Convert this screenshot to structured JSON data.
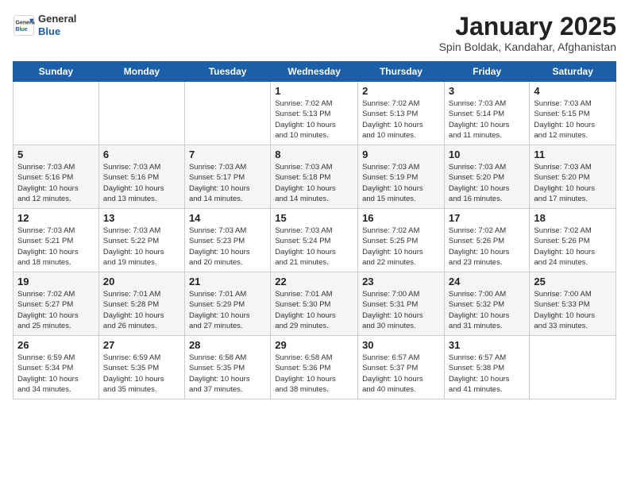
{
  "header": {
    "logo_general": "General",
    "logo_blue": "Blue",
    "month_title": "January 2025",
    "subtitle": "Spin Boldak, Kandahar, Afghanistan"
  },
  "days_of_week": [
    "Sunday",
    "Monday",
    "Tuesday",
    "Wednesday",
    "Thursday",
    "Friday",
    "Saturday"
  ],
  "weeks": [
    [
      {
        "day": "",
        "info": ""
      },
      {
        "day": "",
        "info": ""
      },
      {
        "day": "",
        "info": ""
      },
      {
        "day": "1",
        "info": "Sunrise: 7:02 AM\nSunset: 5:13 PM\nDaylight: 10 hours\nand 10 minutes."
      },
      {
        "day": "2",
        "info": "Sunrise: 7:02 AM\nSunset: 5:13 PM\nDaylight: 10 hours\nand 10 minutes."
      },
      {
        "day": "3",
        "info": "Sunrise: 7:03 AM\nSunset: 5:14 PM\nDaylight: 10 hours\nand 11 minutes."
      },
      {
        "day": "4",
        "info": "Sunrise: 7:03 AM\nSunset: 5:15 PM\nDaylight: 10 hours\nand 12 minutes."
      }
    ],
    [
      {
        "day": "5",
        "info": "Sunrise: 7:03 AM\nSunset: 5:16 PM\nDaylight: 10 hours\nand 12 minutes."
      },
      {
        "day": "6",
        "info": "Sunrise: 7:03 AM\nSunset: 5:16 PM\nDaylight: 10 hours\nand 13 minutes."
      },
      {
        "day": "7",
        "info": "Sunrise: 7:03 AM\nSunset: 5:17 PM\nDaylight: 10 hours\nand 14 minutes."
      },
      {
        "day": "8",
        "info": "Sunrise: 7:03 AM\nSunset: 5:18 PM\nDaylight: 10 hours\nand 14 minutes."
      },
      {
        "day": "9",
        "info": "Sunrise: 7:03 AM\nSunset: 5:19 PM\nDaylight: 10 hours\nand 15 minutes."
      },
      {
        "day": "10",
        "info": "Sunrise: 7:03 AM\nSunset: 5:20 PM\nDaylight: 10 hours\nand 16 minutes."
      },
      {
        "day": "11",
        "info": "Sunrise: 7:03 AM\nSunset: 5:20 PM\nDaylight: 10 hours\nand 17 minutes."
      }
    ],
    [
      {
        "day": "12",
        "info": "Sunrise: 7:03 AM\nSunset: 5:21 PM\nDaylight: 10 hours\nand 18 minutes."
      },
      {
        "day": "13",
        "info": "Sunrise: 7:03 AM\nSunset: 5:22 PM\nDaylight: 10 hours\nand 19 minutes."
      },
      {
        "day": "14",
        "info": "Sunrise: 7:03 AM\nSunset: 5:23 PM\nDaylight: 10 hours\nand 20 minutes."
      },
      {
        "day": "15",
        "info": "Sunrise: 7:03 AM\nSunset: 5:24 PM\nDaylight: 10 hours\nand 21 minutes."
      },
      {
        "day": "16",
        "info": "Sunrise: 7:02 AM\nSunset: 5:25 PM\nDaylight: 10 hours\nand 22 minutes."
      },
      {
        "day": "17",
        "info": "Sunrise: 7:02 AM\nSunset: 5:26 PM\nDaylight: 10 hours\nand 23 minutes."
      },
      {
        "day": "18",
        "info": "Sunrise: 7:02 AM\nSunset: 5:26 PM\nDaylight: 10 hours\nand 24 minutes."
      }
    ],
    [
      {
        "day": "19",
        "info": "Sunrise: 7:02 AM\nSunset: 5:27 PM\nDaylight: 10 hours\nand 25 minutes."
      },
      {
        "day": "20",
        "info": "Sunrise: 7:01 AM\nSunset: 5:28 PM\nDaylight: 10 hours\nand 26 minutes."
      },
      {
        "day": "21",
        "info": "Sunrise: 7:01 AM\nSunset: 5:29 PM\nDaylight: 10 hours\nand 27 minutes."
      },
      {
        "day": "22",
        "info": "Sunrise: 7:01 AM\nSunset: 5:30 PM\nDaylight: 10 hours\nand 29 minutes."
      },
      {
        "day": "23",
        "info": "Sunrise: 7:00 AM\nSunset: 5:31 PM\nDaylight: 10 hours\nand 30 minutes."
      },
      {
        "day": "24",
        "info": "Sunrise: 7:00 AM\nSunset: 5:32 PM\nDaylight: 10 hours\nand 31 minutes."
      },
      {
        "day": "25",
        "info": "Sunrise: 7:00 AM\nSunset: 5:33 PM\nDaylight: 10 hours\nand 33 minutes."
      }
    ],
    [
      {
        "day": "26",
        "info": "Sunrise: 6:59 AM\nSunset: 5:34 PM\nDaylight: 10 hours\nand 34 minutes."
      },
      {
        "day": "27",
        "info": "Sunrise: 6:59 AM\nSunset: 5:35 PM\nDaylight: 10 hours\nand 35 minutes."
      },
      {
        "day": "28",
        "info": "Sunrise: 6:58 AM\nSunset: 5:35 PM\nDaylight: 10 hours\nand 37 minutes."
      },
      {
        "day": "29",
        "info": "Sunrise: 6:58 AM\nSunset: 5:36 PM\nDaylight: 10 hours\nand 38 minutes."
      },
      {
        "day": "30",
        "info": "Sunrise: 6:57 AM\nSunset: 5:37 PM\nDaylight: 10 hours\nand 40 minutes."
      },
      {
        "day": "31",
        "info": "Sunrise: 6:57 AM\nSunset: 5:38 PM\nDaylight: 10 hours\nand 41 minutes."
      },
      {
        "day": "",
        "info": ""
      }
    ]
  ]
}
